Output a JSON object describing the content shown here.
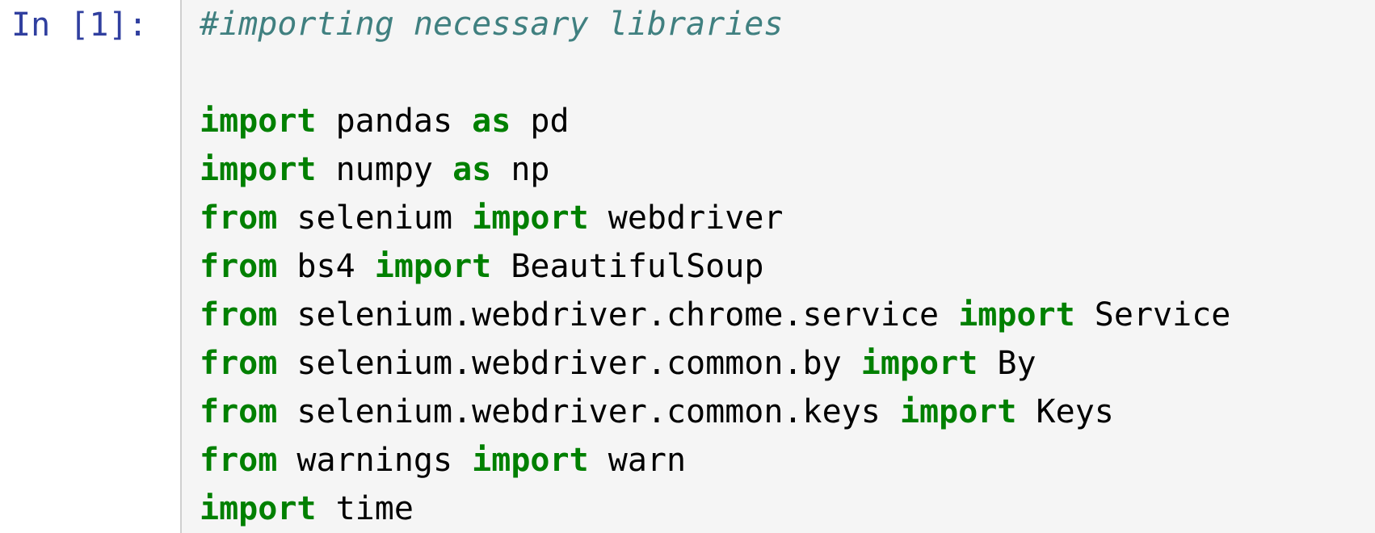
{
  "cell": {
    "prompt": "In [1]:",
    "lines": [
      {
        "segments": [
          {
            "type": "comment",
            "text": "#importing necessary libraries"
          }
        ]
      },
      {
        "segments": []
      },
      {
        "segments": [
          {
            "type": "kw",
            "text": "import"
          },
          {
            "type": "name",
            "text": " pandas "
          },
          {
            "type": "kw",
            "text": "as"
          },
          {
            "type": "name",
            "text": " pd"
          }
        ]
      },
      {
        "segments": [
          {
            "type": "kw",
            "text": "import"
          },
          {
            "type": "name",
            "text": " numpy "
          },
          {
            "type": "kw",
            "text": "as"
          },
          {
            "type": "name",
            "text": " np"
          }
        ]
      },
      {
        "segments": [
          {
            "type": "kw",
            "text": "from"
          },
          {
            "type": "name",
            "text": " selenium "
          },
          {
            "type": "kw",
            "text": "import"
          },
          {
            "type": "name",
            "text": " webdriver"
          }
        ]
      },
      {
        "segments": [
          {
            "type": "kw",
            "text": "from"
          },
          {
            "type": "name",
            "text": " bs4 "
          },
          {
            "type": "kw",
            "text": "import"
          },
          {
            "type": "name",
            "text": " BeautifulSoup"
          }
        ]
      },
      {
        "segments": [
          {
            "type": "kw",
            "text": "from"
          },
          {
            "type": "name",
            "text": " selenium.webdriver.chrome.service "
          },
          {
            "type": "kw",
            "text": "import"
          },
          {
            "type": "name",
            "text": " Service"
          }
        ]
      },
      {
        "segments": [
          {
            "type": "kw",
            "text": "from"
          },
          {
            "type": "name",
            "text": " selenium.webdriver.common.by "
          },
          {
            "type": "kw",
            "text": "import"
          },
          {
            "type": "name",
            "text": " By"
          }
        ]
      },
      {
        "segments": [
          {
            "type": "kw",
            "text": "from"
          },
          {
            "type": "name",
            "text": " selenium.webdriver.common.keys "
          },
          {
            "type": "kw",
            "text": "import"
          },
          {
            "type": "name",
            "text": " Keys"
          }
        ]
      },
      {
        "segments": [
          {
            "type": "kw",
            "text": "from"
          },
          {
            "type": "name",
            "text": " warnings "
          },
          {
            "type": "kw",
            "text": "import"
          },
          {
            "type": "name",
            "text": " warn"
          }
        ]
      },
      {
        "segments": [
          {
            "type": "kw",
            "text": "import"
          },
          {
            "type": "name",
            "text": " time"
          }
        ]
      }
    ]
  },
  "colors": {
    "prompt": "#303f9f",
    "keyword": "#008000",
    "comment": "#408080",
    "cell_background": "#f5f5f5",
    "cell_border": "#cfcfcf"
  }
}
